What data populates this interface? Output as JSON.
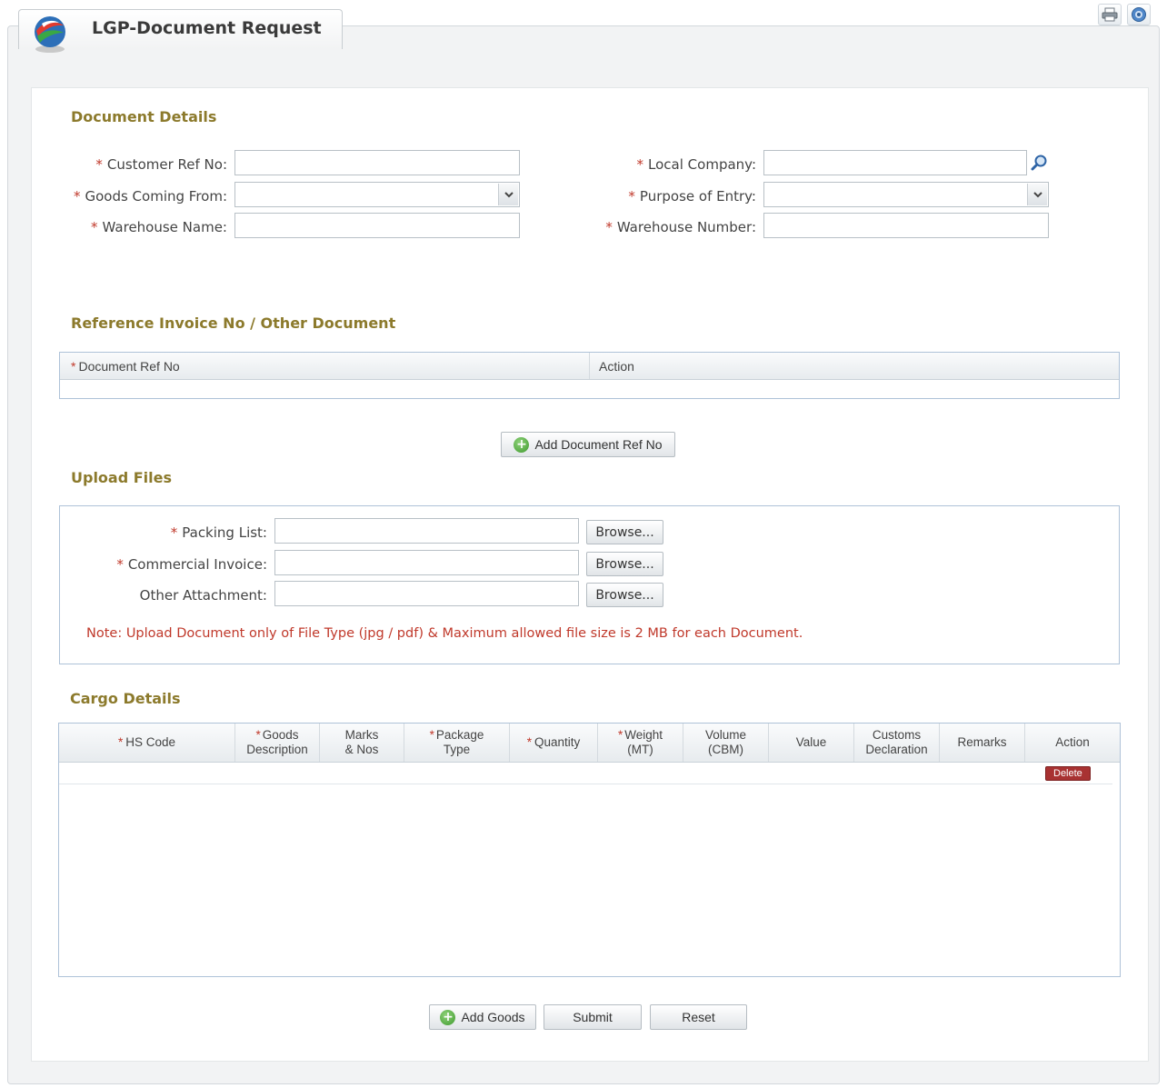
{
  "page": {
    "title": "LGP-Document Request"
  },
  "toolbar": {
    "print_icon": "printer-icon",
    "help_icon": "help-icon"
  },
  "document_details": {
    "title": "Document Details",
    "customer_ref": {
      "label": "Customer Ref No:",
      "value": ""
    },
    "goods_from": {
      "label": "Goods Coming From:",
      "value": ""
    },
    "warehouse_name": {
      "label": "Warehouse Name:",
      "value": ""
    },
    "local_company": {
      "label": "Local Company:",
      "value": ""
    },
    "purpose": {
      "label": "Purpose of Entry:",
      "value": ""
    },
    "warehouse_number": {
      "label": "Warehouse Number:",
      "value": ""
    }
  },
  "reference": {
    "title": "Reference Invoice No / Other Document",
    "columns": [
      "Document Ref No",
      "Action"
    ],
    "add_button": "Add Document Ref No"
  },
  "upload": {
    "title": "Upload Files",
    "packing": {
      "label": "Packing List:",
      "button": "Browse..."
    },
    "invoice": {
      "label": "Commercial Invoice:",
      "button": "Browse..."
    },
    "other": {
      "label": "Other Attachment:",
      "button": "Browse..."
    },
    "note": "Note: Upload Document only of File Type (jpg / pdf) & Maximum allowed file size is 2 MB for each Document."
  },
  "cargo": {
    "title": "Cargo Details",
    "columns": {
      "hs": "HS Code",
      "goods": [
        "Goods",
        "Description"
      ],
      "marks": [
        "Marks",
        "& Nos"
      ],
      "pkg": [
        "Package",
        "Type"
      ],
      "qty": "Quantity",
      "weight": [
        "Weight",
        "(MT)"
      ],
      "volume": [
        "Volume",
        "(CBM)"
      ],
      "value": "Value",
      "customs": [
        "Customs",
        "Declaration"
      ],
      "remarks": "Remarks",
      "action": "Action"
    },
    "delete_label": "Delete"
  },
  "actions": {
    "add_goods": "Add Goods",
    "submit": "Submit",
    "reset": "Reset"
  },
  "colors": {
    "section_title": "#8c7a2c",
    "required": "#c0392b",
    "grid_border": "#aec2d8",
    "delete": "#a83232"
  }
}
